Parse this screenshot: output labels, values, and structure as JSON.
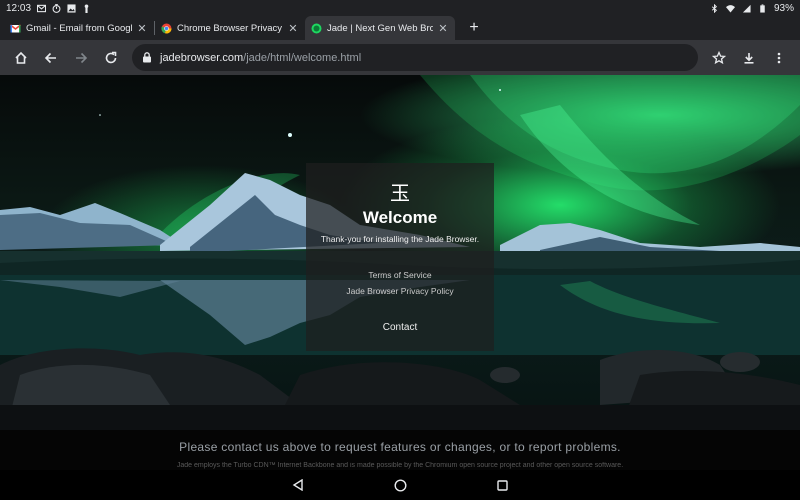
{
  "status_bar": {
    "time": "12:03",
    "battery": "93%",
    "left_icons": [
      "gmail-notification-icon",
      "timer-icon",
      "image-icon",
      "lock-notification-icon"
    ],
    "right_icons": [
      "bluetooth-icon",
      "wifi-icon",
      "signal-icon",
      "battery-icon"
    ]
  },
  "tabs": [
    {
      "title": "Gmail - Email from Google",
      "favicon": "gmail-icon",
      "active": false
    },
    {
      "title": "Chrome Browser Privacy Poli",
      "favicon": "chrome-icon",
      "active": false
    },
    {
      "title": "Jade | Next Gen Web Browser",
      "favicon": "jade-icon",
      "active": true
    }
  ],
  "new_tab_label": "+",
  "close_label": "✕",
  "omnibox": {
    "domain": "jadebrowser.com",
    "path": "/jade/html/welcome.html"
  },
  "card": {
    "logo": "玉",
    "title": "Welcome",
    "subtitle": "Thank-you for installing the Jade Browser.",
    "links": {
      "terms": "Terms of Service",
      "privacy": "Jade Browser Privacy Policy",
      "contact": "Contact"
    }
  },
  "footer": {
    "main": "Please contact us above to request features or changes, or to report problems.",
    "small": "Jade employs the Turbo CDN™ Internet Backbone and is made possible by the Chromium open source project and other open source software."
  },
  "colors": {
    "chrome_dark": "#202124",
    "toolbar": "#35363a",
    "aurora": "#28ff78"
  }
}
